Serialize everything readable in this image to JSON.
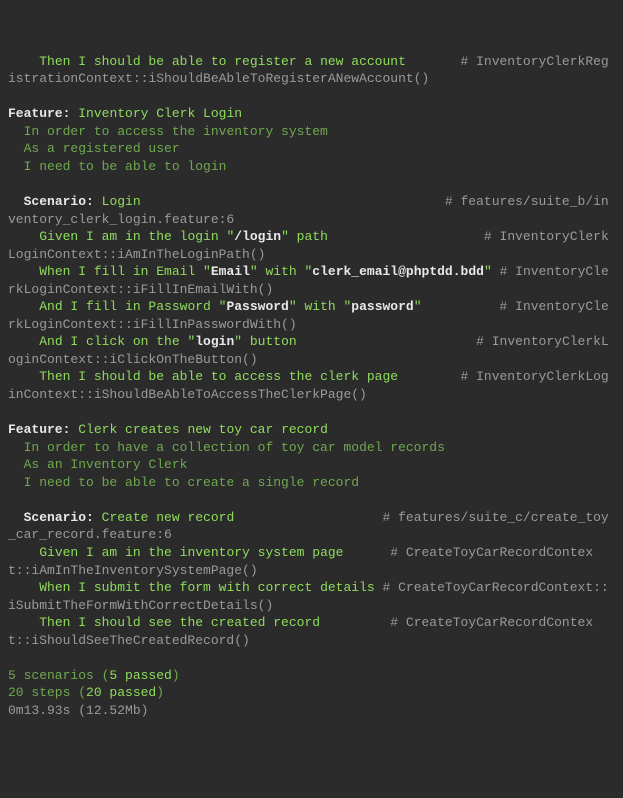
{
  "pre": {
    "step1_text": "Then I should be able to register a new account",
    "step1_ctx": "# InventoryClerkRegistrationContext::iShouldBeAbleToRegisterANewAccount()"
  },
  "featA": {
    "kw": "Feature:",
    "title": "Inventory Clerk Login",
    "narr1": "In order to access the inventory system",
    "narr2": "As a registered user",
    "narr3": "I need to be able to login",
    "scen_kw": "Scenario:",
    "scen_title": "Login",
    "scen_loc": "# features/suite_b/inventory_clerk_login.feature:6",
    "s1_a": "Given I am in the login \"",
    "s1_b": "/login",
    "s1_c": "\" path",
    "s1_ctx": "# InventoryClerkLoginContext::iAmInTheLoginPath()",
    "s2_a": "When I fill in Email \"",
    "s2_b": "Email",
    "s2_c": "\" with \"",
    "s2_d": "clerk_email@phptdd.bdd",
    "s2_e": "\"",
    "s2_ctx": "# InventoryClerkLoginContext::iFillInEmailWith()",
    "s3_a": "And I fill in Password \"",
    "s3_b": "Password",
    "s3_c": "\" with \"",
    "s3_d": "password",
    "s3_e": "\"",
    "s3_ctx": "# InventoryClerkLoginContext::iFillInPasswordWith()",
    "s4_a": "And I click on the \"",
    "s4_b": "login",
    "s4_c": "\" button",
    "s4_ctx": "# InventoryClerkLoginContext::iClickOnTheButton()",
    "s5": "Then I should be able to access the clerk page",
    "s5_ctx": "# InventoryClerkLoginContext::iShouldBeAbleToAccessTheClerkPage()"
  },
  "featB": {
    "kw": "Feature:",
    "title": "Clerk creates new toy car record",
    "narr1": "In order to have a collection of toy car model records",
    "narr2": "As an Inventory Clerk",
    "narr3": "I need to be able to create a single record",
    "scen_kw": "Scenario:",
    "scen_title": "Create new record",
    "scen_loc": "# features/suite_c/create_toy_car_record.feature:6",
    "s1": "Given I am in the inventory system page",
    "s1_ctx": "# CreateToyCarRecordContext::iAmInTheInventorySystemPage()",
    "s2": "When I submit the form with correct details",
    "s2_ctx": "# CreateToyCarRecordContext::iSubmitTheFormWithCorrectDetails()",
    "s3": "Then I should see the created record",
    "s3_ctx": "# CreateToyCarRecordContext::iShouldSeeTheCreatedRecord()"
  },
  "summary": {
    "scen_a": "5 scenarios (",
    "scen_b": "5 passed",
    "scen_c": ")",
    "steps_a": "20 steps (",
    "steps_b": "20 passed",
    "steps_c": ")",
    "time": "0m13.93s (12.52Mb)"
  }
}
